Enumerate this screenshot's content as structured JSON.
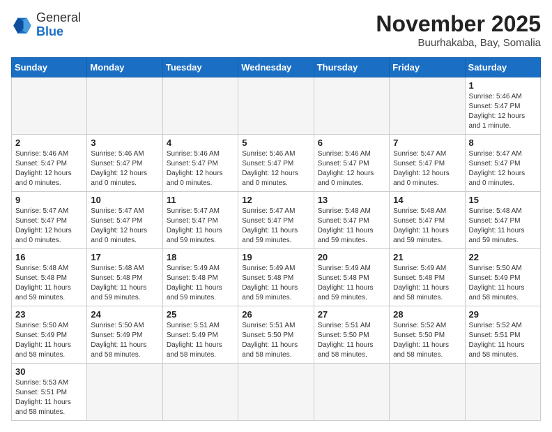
{
  "header": {
    "logo_general": "General",
    "logo_blue": "Blue",
    "month_title": "November 2025",
    "location": "Buurhakaba, Bay, Somalia"
  },
  "weekdays": [
    "Sunday",
    "Monday",
    "Tuesday",
    "Wednesday",
    "Thursday",
    "Friday",
    "Saturday"
  ],
  "days": [
    {
      "day": "",
      "info": ""
    },
    {
      "day": "",
      "info": ""
    },
    {
      "day": "",
      "info": ""
    },
    {
      "day": "",
      "info": ""
    },
    {
      "day": "",
      "info": ""
    },
    {
      "day": "",
      "info": ""
    },
    {
      "day": "1",
      "info": "Sunrise: 5:46 AM\nSunset: 5:47 PM\nDaylight: 12 hours\nand 1 minute."
    },
    {
      "day": "2",
      "info": "Sunrise: 5:46 AM\nSunset: 5:47 PM\nDaylight: 12 hours\nand 0 minutes."
    },
    {
      "day": "3",
      "info": "Sunrise: 5:46 AM\nSunset: 5:47 PM\nDaylight: 12 hours\nand 0 minutes."
    },
    {
      "day": "4",
      "info": "Sunrise: 5:46 AM\nSunset: 5:47 PM\nDaylight: 12 hours\nand 0 minutes."
    },
    {
      "day": "5",
      "info": "Sunrise: 5:46 AM\nSunset: 5:47 PM\nDaylight: 12 hours\nand 0 minutes."
    },
    {
      "day": "6",
      "info": "Sunrise: 5:46 AM\nSunset: 5:47 PM\nDaylight: 12 hours\nand 0 minutes."
    },
    {
      "day": "7",
      "info": "Sunrise: 5:47 AM\nSunset: 5:47 PM\nDaylight: 12 hours\nand 0 minutes."
    },
    {
      "day": "8",
      "info": "Sunrise: 5:47 AM\nSunset: 5:47 PM\nDaylight: 12 hours\nand 0 minutes."
    },
    {
      "day": "9",
      "info": "Sunrise: 5:47 AM\nSunset: 5:47 PM\nDaylight: 12 hours\nand 0 minutes."
    },
    {
      "day": "10",
      "info": "Sunrise: 5:47 AM\nSunset: 5:47 PM\nDaylight: 12 hours\nand 0 minutes."
    },
    {
      "day": "11",
      "info": "Sunrise: 5:47 AM\nSunset: 5:47 PM\nDaylight: 11 hours\nand 59 minutes."
    },
    {
      "day": "12",
      "info": "Sunrise: 5:47 AM\nSunset: 5:47 PM\nDaylight: 11 hours\nand 59 minutes."
    },
    {
      "day": "13",
      "info": "Sunrise: 5:48 AM\nSunset: 5:47 PM\nDaylight: 11 hours\nand 59 minutes."
    },
    {
      "day": "14",
      "info": "Sunrise: 5:48 AM\nSunset: 5:47 PM\nDaylight: 11 hours\nand 59 minutes."
    },
    {
      "day": "15",
      "info": "Sunrise: 5:48 AM\nSunset: 5:47 PM\nDaylight: 11 hours\nand 59 minutes."
    },
    {
      "day": "16",
      "info": "Sunrise: 5:48 AM\nSunset: 5:48 PM\nDaylight: 11 hours\nand 59 minutes."
    },
    {
      "day": "17",
      "info": "Sunrise: 5:48 AM\nSunset: 5:48 PM\nDaylight: 11 hours\nand 59 minutes."
    },
    {
      "day": "18",
      "info": "Sunrise: 5:49 AM\nSunset: 5:48 PM\nDaylight: 11 hours\nand 59 minutes."
    },
    {
      "day": "19",
      "info": "Sunrise: 5:49 AM\nSunset: 5:48 PM\nDaylight: 11 hours\nand 59 minutes."
    },
    {
      "day": "20",
      "info": "Sunrise: 5:49 AM\nSunset: 5:48 PM\nDaylight: 11 hours\nand 59 minutes."
    },
    {
      "day": "21",
      "info": "Sunrise: 5:49 AM\nSunset: 5:48 PM\nDaylight: 11 hours\nand 58 minutes."
    },
    {
      "day": "22",
      "info": "Sunrise: 5:50 AM\nSunset: 5:49 PM\nDaylight: 11 hours\nand 58 minutes."
    },
    {
      "day": "23",
      "info": "Sunrise: 5:50 AM\nSunset: 5:49 PM\nDaylight: 11 hours\nand 58 minutes."
    },
    {
      "day": "24",
      "info": "Sunrise: 5:50 AM\nSunset: 5:49 PM\nDaylight: 11 hours\nand 58 minutes."
    },
    {
      "day": "25",
      "info": "Sunrise: 5:51 AM\nSunset: 5:49 PM\nDaylight: 11 hours\nand 58 minutes."
    },
    {
      "day": "26",
      "info": "Sunrise: 5:51 AM\nSunset: 5:50 PM\nDaylight: 11 hours\nand 58 minutes."
    },
    {
      "day": "27",
      "info": "Sunrise: 5:51 AM\nSunset: 5:50 PM\nDaylight: 11 hours\nand 58 minutes."
    },
    {
      "day": "28",
      "info": "Sunrise: 5:52 AM\nSunset: 5:50 PM\nDaylight: 11 hours\nand 58 minutes."
    },
    {
      "day": "29",
      "info": "Sunrise: 5:52 AM\nSunset: 5:51 PM\nDaylight: 11 hours\nand 58 minutes."
    },
    {
      "day": "30",
      "info": "Sunrise: 5:53 AM\nSunset: 5:51 PM\nDaylight: 11 hours\nand 58 minutes."
    },
    {
      "day": "",
      "info": ""
    },
    {
      "day": "",
      "info": ""
    },
    {
      "day": "",
      "info": ""
    },
    {
      "day": "",
      "info": ""
    },
    {
      "day": "",
      "info": ""
    },
    {
      "day": "",
      "info": ""
    }
  ]
}
